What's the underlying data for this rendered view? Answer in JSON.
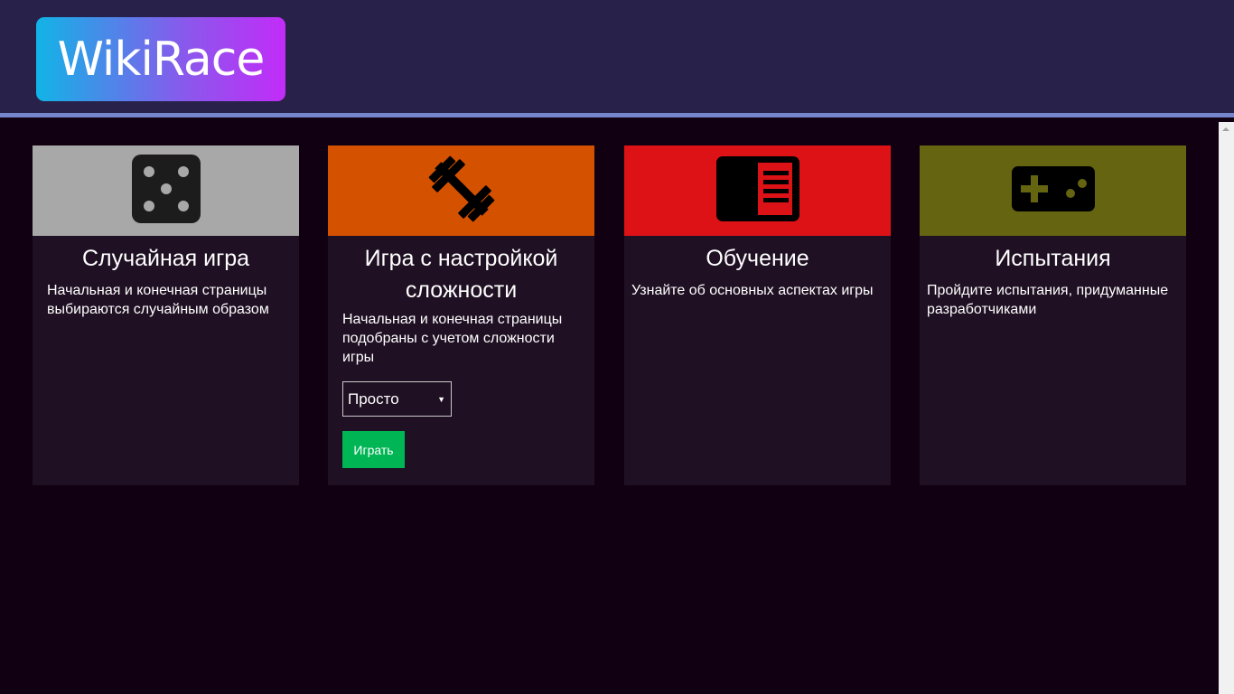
{
  "header": {
    "logo_text": "WikiRace"
  },
  "colors": {
    "header_bg": "#28224b",
    "header_border": "#7686cc",
    "page_bg": "#110012",
    "card_bg": "#1f1023",
    "random_banner": "#a8a8a8",
    "difficulty_banner": "#d45100",
    "tutorial_banner": "#dd1216",
    "challenges_banner": "#646411",
    "play_button": "#00b554"
  },
  "cards": [
    {
      "title": "Случайная игра",
      "description": "Начальная и конечная страницы выбираются случайным образом",
      "icon": "dice-icon"
    },
    {
      "title": "Игра с настройкой сложности",
      "description": "Начальная и конечная страницы подобраны с учетом сложности игры",
      "icon": "dumbbell-icon",
      "difficulty_selected": "Просто",
      "play_label": "Играть"
    },
    {
      "title": "Обучение",
      "description": "Узнайте об основных аспектах игры",
      "icon": "book-icon"
    },
    {
      "title": "Испытания",
      "description": "Пройдите испытания, придуманные разработчиками",
      "icon": "gamepad-icon"
    }
  ]
}
